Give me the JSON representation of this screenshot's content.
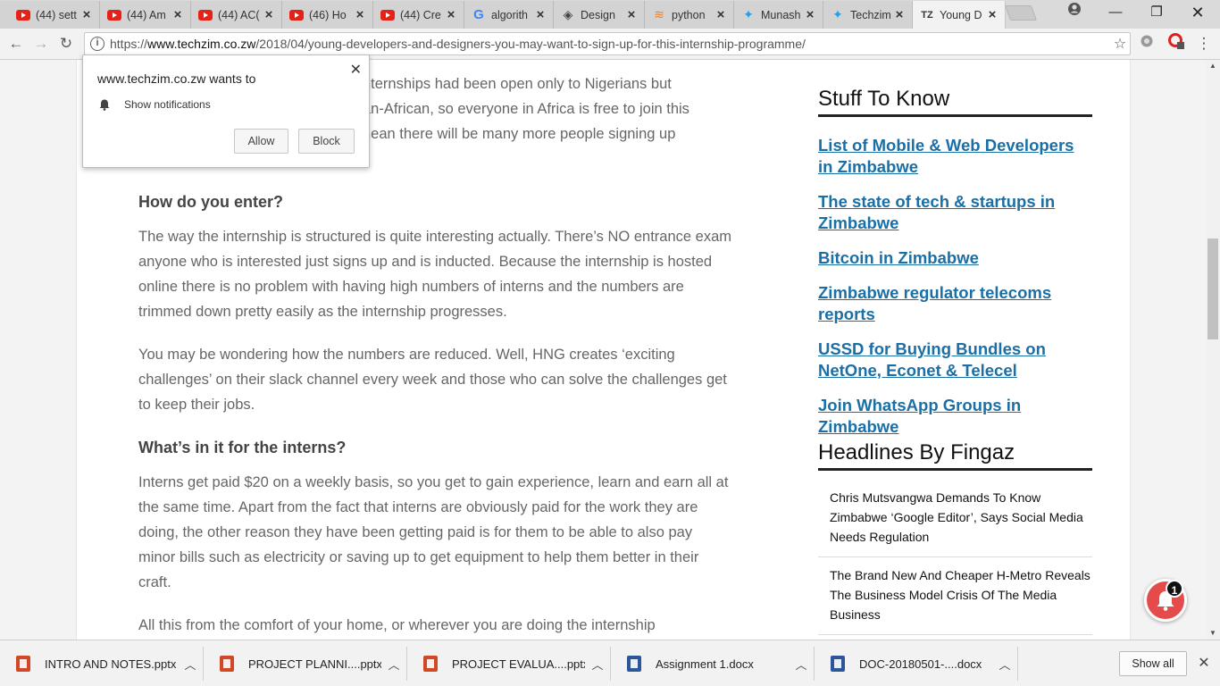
{
  "browser": {
    "tabs": [
      {
        "title": "(44) sett",
        "icon": "youtube-icon"
      },
      {
        "title": "(44) Am",
        "icon": "youtube-icon"
      },
      {
        "title": "(44) AC(",
        "icon": "youtube-icon"
      },
      {
        "title": "(46) Ho",
        "icon": "youtube-icon"
      },
      {
        "title": "(44) Cre",
        "icon": "youtube-icon"
      },
      {
        "title": "algorith",
        "icon": "google-icon"
      },
      {
        "title": "Design",
        "icon": "design-icon"
      },
      {
        "title": "python",
        "icon": "stackoverflow-icon"
      },
      {
        "title": "Munash",
        "icon": "twitter-icon"
      },
      {
        "title": "Techzim",
        "icon": "twitter-icon"
      },
      {
        "title": "Young D",
        "icon": "techzim-icon",
        "icon_text": "TZ"
      }
    ],
    "url_scheme": "https://",
    "url_host": "www.techzim.co.zw",
    "url_path": "/2018/04/young-developers-and-designers-you-may-want-to-sign-up-for-this-internship-programme/"
  },
  "notification_prompt": {
    "title": "www.techzim.co.zw wants to",
    "permission": "Show notifications",
    "allow_label": "Allow",
    "block_label": "Block"
  },
  "article": {
    "partial_lines": [
      "nternships had been open only to Nigerians but",
      "an-African, so everyone in Africa is free to join this",
      "nean there will be many more people signing up"
    ],
    "heading_enter": "How do you enter?",
    "para_structure": "The way the internship is structured is quite interesting actually. There’s NO entrance exam anyone who is interested just signs up and is inducted. Because the internship is hosted online there is no problem with having high numbers of interns and the numbers are trimmed down pretty easily as the internship progresses.",
    "para_reduced": "You may be wondering how the numbers are reduced. Well, HNG creates ‘exciting challenges’ on their slack channel every week and those who can solve the challenges get to keep their jobs.",
    "heading_interns": "What’s in it for the interns?",
    "para_paid": "Interns get paid $20 on a weekly basis, so you get to gain experience, learn and earn all at the same time. Apart from the fact that interns are obviously paid for the work they are doing, the other reason they have been getting paid is for them to be able to also pay minor bills such as electricity or saving up to get equipment to help them better in their craft.",
    "para_comfort": "All this from the comfort of your home, or wherever you are doing the internship"
  },
  "sidebar": {
    "stuff_heading": "Stuff To Know",
    "links": [
      "List of Mobile & Web Developers in Zimbabwe",
      "The state of tech & startups in Zimbabwe",
      "Bitcoin in Zimbabwe",
      "Zimbabwe regulator telecoms reports",
      "USSD for Buying Bundles on NetOne, Econet & Telecel",
      "Join WhatsApp Groups in Zimbabwe"
    ],
    "headlines_heading": "Headlines By Fingaz",
    "headlines": [
      "Chris Mutsvangwa Demands To Know Zimbabwe ‘Google Editor’, Says Social Media Needs Regulation",
      "The Brand New And Cheaper H-Metro Reveals The Business Model Crisis Of The Media Business"
    ]
  },
  "notification_badge": "1",
  "downloads": {
    "items": [
      {
        "name": "INTRO AND NOTES.pptx",
        "type": "ppt"
      },
      {
        "name": "PROJECT PLANNI....pptx",
        "type": "ppt"
      },
      {
        "name": "PROJECT EVALUA....pptx",
        "type": "ppt"
      },
      {
        "name": "Assignment 1.docx",
        "type": "doc"
      },
      {
        "name": "DOC-20180501-....docx",
        "type": "doc"
      }
    ],
    "show_all_label": "Show all"
  }
}
